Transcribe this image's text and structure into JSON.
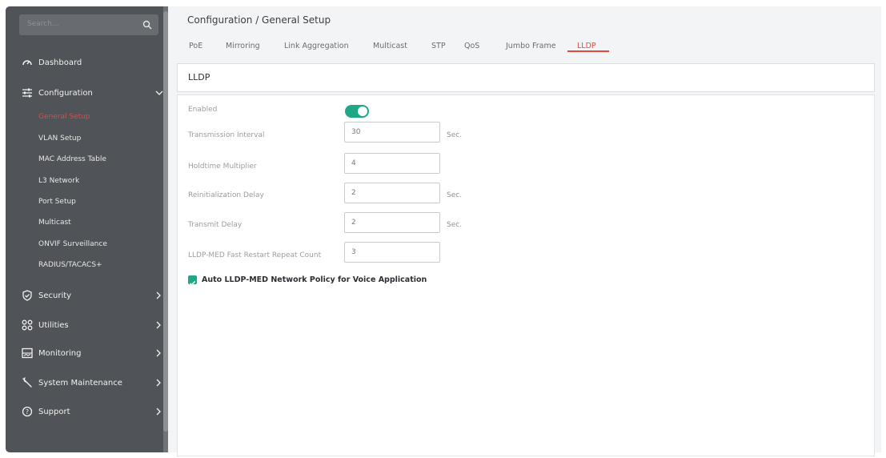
{
  "sidebar": {
    "search": {
      "placeholder": "Search..."
    },
    "dashboard": {
      "label": "Dashboard"
    },
    "configuration": {
      "label": "Configuration",
      "items": [
        {
          "label": "General Setup",
          "active": true
        },
        {
          "label": "VLAN Setup"
        },
        {
          "label": "MAC Address Table"
        },
        {
          "label": "L3 Network"
        },
        {
          "label": "Port Setup"
        },
        {
          "label": "Multicast"
        },
        {
          "label": "ONVIF Surveillance"
        },
        {
          "label": "RADIUS/TACACS+"
        }
      ]
    },
    "security": {
      "label": "Security"
    },
    "utilities": {
      "label": "Utilities"
    },
    "monitoring": {
      "label": "Monitoring"
    },
    "system_maintenance": {
      "label": "System Maintenance"
    },
    "support": {
      "label": "Support"
    }
  },
  "header": {
    "breadcrumb": "Configuration / General Setup",
    "tabs": [
      {
        "label": "PoE"
      },
      {
        "label": "Mirroring"
      },
      {
        "label": "Link Aggregation"
      },
      {
        "label": "Multicast"
      },
      {
        "label": "STP"
      },
      {
        "label": "QoS"
      },
      {
        "label": "Jumbo Frame"
      },
      {
        "label": "LLDP",
        "active": true
      }
    ]
  },
  "section": {
    "title": "LLDP"
  },
  "form": {
    "enabled": {
      "label": "Enabled",
      "value": true
    },
    "transmission_interval": {
      "label": "Transmission Interval",
      "value": "30",
      "unit": "Sec."
    },
    "holdtime_multiplier": {
      "label": "Holdtime Multiplier",
      "value": "4"
    },
    "reinitialization_delay": {
      "label": "Reinitialization Delay",
      "value": "2",
      "unit": "Sec."
    },
    "transmit_delay": {
      "label": "Transmit Delay",
      "value": "2",
      "unit": "Sec."
    },
    "fast_restart_repeat_count": {
      "label": "LLDP-MED Fast Restart Repeat Count",
      "value": "3"
    },
    "auto_policy": {
      "label": "Auto LLDP-MED Network Policy for Voice Application",
      "checked": true
    }
  },
  "colors": {
    "accent": "#e8473a",
    "toggle_on": "#1fa886",
    "sidebar_bg": "#505357"
  }
}
